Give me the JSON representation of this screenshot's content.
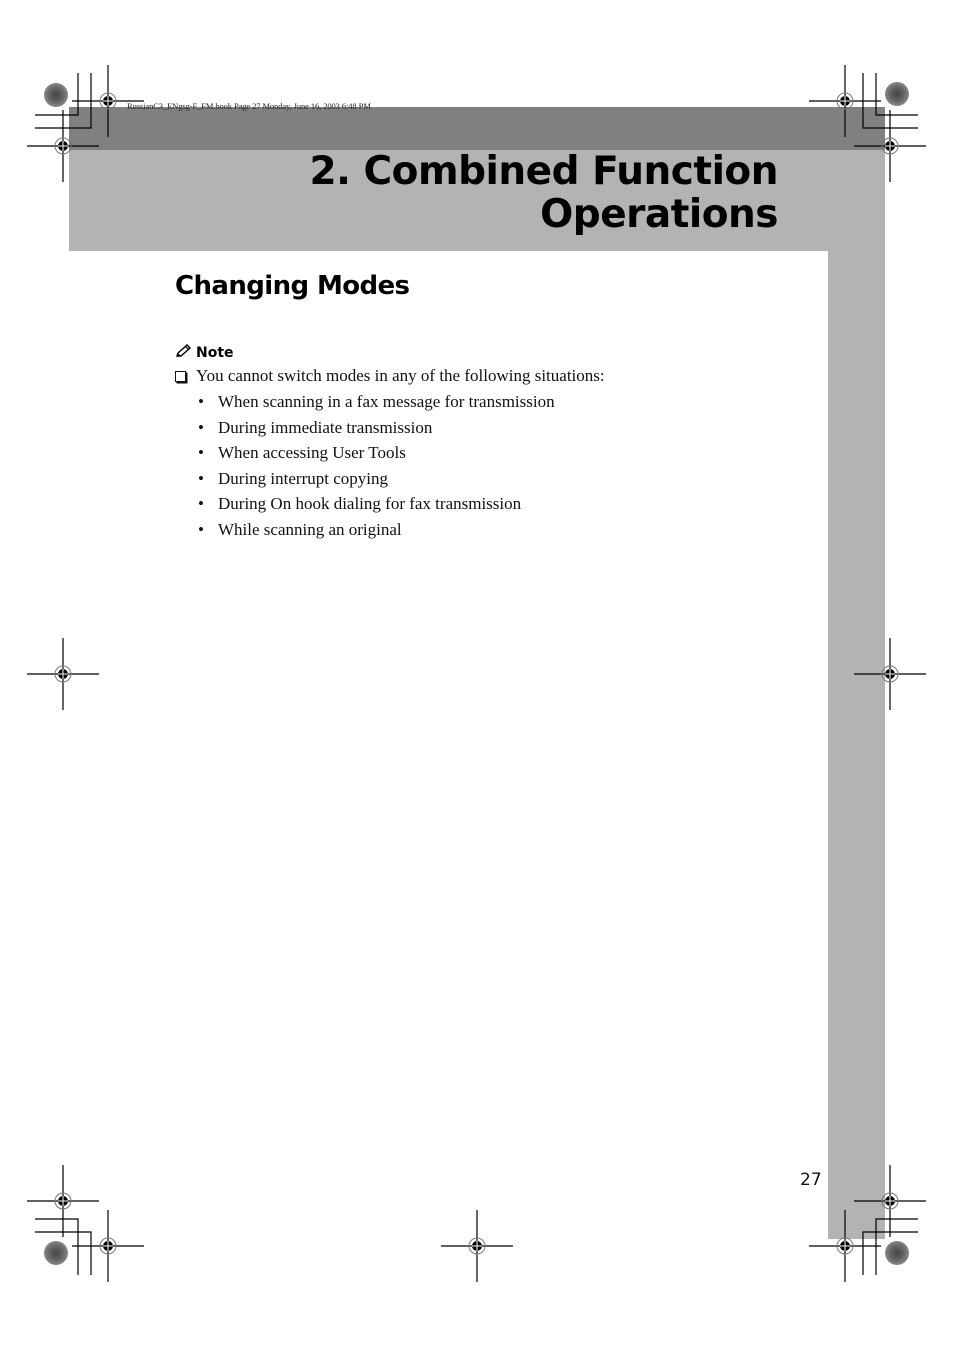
{
  "header": {
    "slug": "RussianC3_ENgsg-F_FM.book  Page 27  Monday, June 16, 2003  6:48 PM",
    "chapter_title_line1": "2. Combined Function",
    "chapter_title_line2": "Operations"
  },
  "section": {
    "title": "Changing Modes"
  },
  "note": {
    "icon": "pencil-icon",
    "heading": "Note",
    "checkbox_icon": "checkbox-icon",
    "text": "You cannot switch modes in any of the following situations:",
    "bullets": [
      "When scanning in a fax message for transmission",
      "During immediate transmission",
      "When accessing User Tools",
      "During interrupt copying",
      "During On hook dialing for fax transmission",
      "While scanning an original"
    ]
  },
  "footer": {
    "page_number": "27"
  },
  "colors": {
    "band_dark": "#808080",
    "band_light": "#b3b3b3",
    "text": "#111111"
  }
}
